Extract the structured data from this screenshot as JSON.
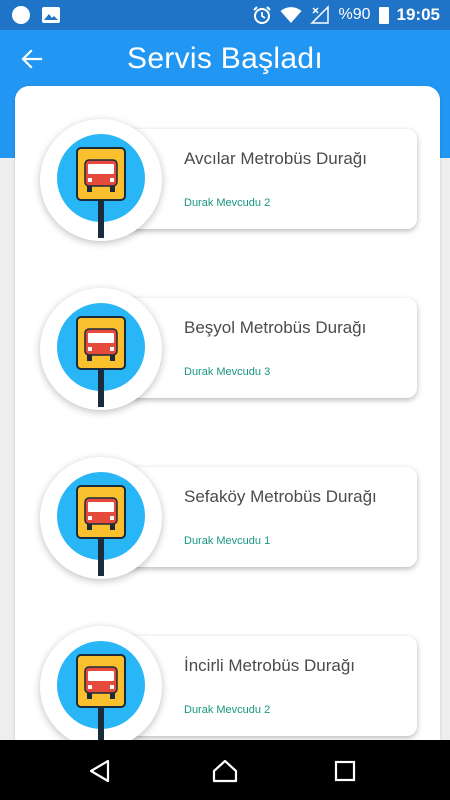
{
  "status_bar": {
    "battery_text": "%90",
    "time": "19:05",
    "icons": [
      "notification-dot-icon",
      "image-icon",
      "alarm-icon",
      "wifi-icon",
      "no-signal-icon",
      "battery-icon"
    ]
  },
  "header": {
    "title": "Servis Başladı",
    "back_icon": "arrow-left-icon",
    "background": "#2196f3"
  },
  "stops": [
    {
      "name": "Avcılar Metrobüs Durağı",
      "status": "Durak Mevcudu 2"
    },
    {
      "name": "Beşyol Metrobüs Durağı",
      "status": "Durak Mevcudu 3"
    },
    {
      "name": "Sefaköy Metrobüs Durağı",
      "status": "Durak Mevcudu 1"
    },
    {
      "name": "İncirli Metrobüs Durağı",
      "status": "Durak Mevcudu 2"
    }
  ],
  "colors": {
    "accent_blue": "#2196f3",
    "status_teal": "#17977f",
    "sign_yellow": "#fbc02d",
    "bus_red": "#e64a3c",
    "circle_blue": "#29b6f6"
  },
  "nav_bar": {
    "icons": [
      "back-triangle-icon",
      "home-icon",
      "recents-square-icon"
    ]
  }
}
